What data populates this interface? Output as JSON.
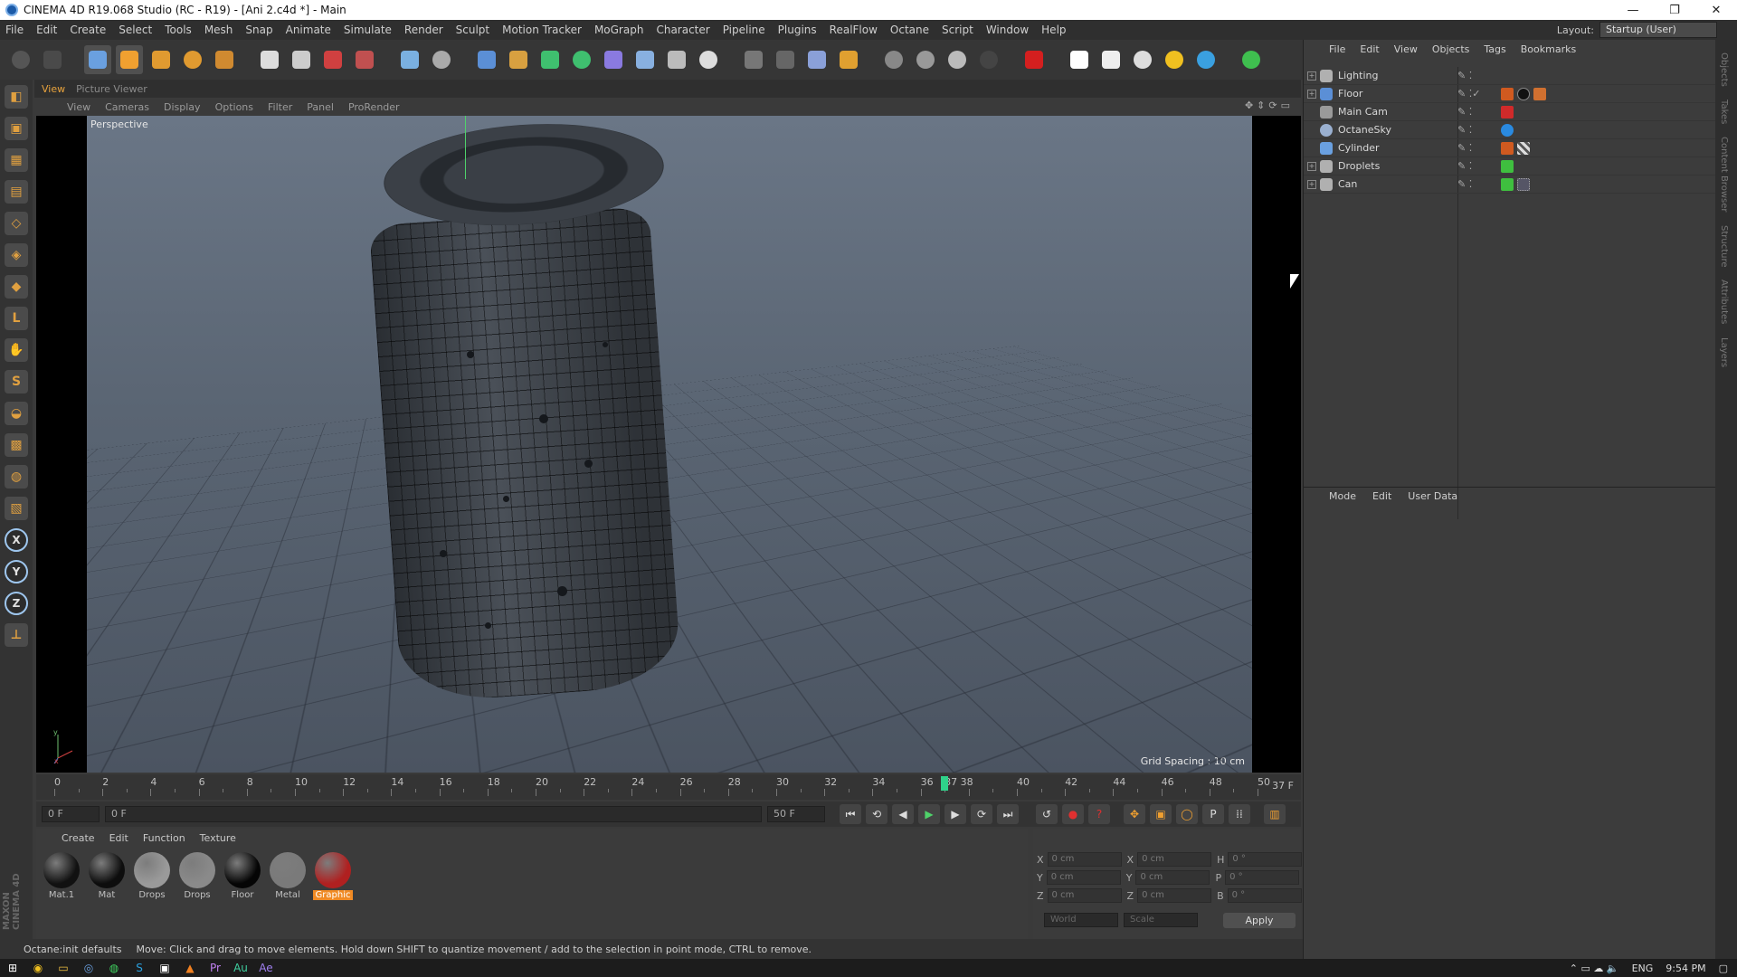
{
  "window": {
    "title": "CINEMA 4D R19.068 Studio (RC - R19) - [Ani 2.c4d *] - Main",
    "controls": [
      "—",
      "❐",
      "✕"
    ]
  },
  "menubar": {
    "items": [
      "File",
      "Edit",
      "Create",
      "Select",
      "Tools",
      "Mesh",
      "Snap",
      "Animate",
      "Simulate",
      "Render",
      "Sculpt",
      "Motion Tracker",
      "MoGraph",
      "Character",
      "Pipeline",
      "Plugins",
      "RealFlow",
      "Octane",
      "Script",
      "Window",
      "Help"
    ],
    "layout_label": "Layout:",
    "layout_value": "Startup (User)"
  },
  "viewport": {
    "tabs": [
      "View",
      "Picture Viewer"
    ],
    "menu": [
      "View",
      "Cameras",
      "Display",
      "Options",
      "Filter",
      "Panel",
      "ProRender"
    ],
    "label": "Perspective",
    "grid_spacing": "Grid Spacing : 10 cm"
  },
  "timeline": {
    "ticks": [
      "0",
      "2",
      "4",
      "6",
      "8",
      "10",
      "12",
      "14",
      "16",
      "18",
      "20",
      "22",
      "24",
      "26",
      "28",
      "30",
      "32",
      "34",
      "36",
      "37 38",
      "40",
      "42",
      "44",
      "46",
      "48",
      "50"
    ],
    "current_frame": "37 F",
    "playhead_frame": 37,
    "start_field": "0 F",
    "min_field": "0 F",
    "max_field": "50 F",
    "end_field": "50 F"
  },
  "materials": {
    "menu": [
      "Create",
      "Edit",
      "Function",
      "Texture"
    ],
    "items": [
      {
        "name": "Mat.1",
        "color": "#111111"
      },
      {
        "name": "Mat",
        "color": "#0d0d0d"
      },
      {
        "name": "Drops",
        "color": "#9a9a9a"
      },
      {
        "name": "Drops",
        "color": "#8a8a8a"
      },
      {
        "name": "Floor",
        "color": "#050505"
      },
      {
        "name": "Metal",
        "color": "#7a7a7a"
      },
      {
        "name": "Graphic",
        "color": "#b02020"
      }
    ],
    "selected": "Graphic"
  },
  "coordinates": {
    "rows": [
      {
        "a": "X",
        "av": "0 cm",
        "b": "X",
        "bv": "0 cm",
        "c": "H",
        "cv": "0 °"
      },
      {
        "a": "Y",
        "av": "0 cm",
        "b": "Y",
        "bv": "0 cm",
        "c": "P",
        "cv": "0 °"
      },
      {
        "a": "Z",
        "av": "0 cm",
        "b": "Z",
        "bv": "0 cm",
        "c": "B",
        "cv": "0 °"
      }
    ],
    "mode": "World",
    "scale": "Scale",
    "apply": "Apply"
  },
  "status": {
    "left": "Octane:init defaults",
    "message": "Move: Click and drag to move elements. Hold down SHIFT to quantize movement / add to the selection in point mode, CTRL to remove."
  },
  "object_manager": {
    "menu": [
      "File",
      "Edit",
      "View",
      "Objects",
      "Tags",
      "Bookmarks"
    ],
    "objects": [
      {
        "name": "Lighting",
        "icon_color": "#b0b0b0"
      },
      {
        "name": "Floor",
        "icon_color": "#5b8fd6"
      },
      {
        "name": "Main Cam",
        "icon_color": "#9a9a9a"
      },
      {
        "name": "OctaneSky",
        "icon_color": "#9ab0d0"
      },
      {
        "name": "Cylinder",
        "icon_color": "#6aa0e0"
      },
      {
        "name": "Droplets",
        "icon_color": "#b0b0b0"
      },
      {
        "name": "Can",
        "icon_color": "#b0b0b0"
      }
    ]
  },
  "attributes": {
    "menu": [
      "Mode",
      "Edit",
      "User Data"
    ]
  },
  "sidetabs": [
    "Objects",
    "Takes",
    "Content Browser",
    "Structure",
    "Attributes",
    "Layers"
  ],
  "taskbar": {
    "lang": "ENG",
    "time": "9:54 PM"
  }
}
